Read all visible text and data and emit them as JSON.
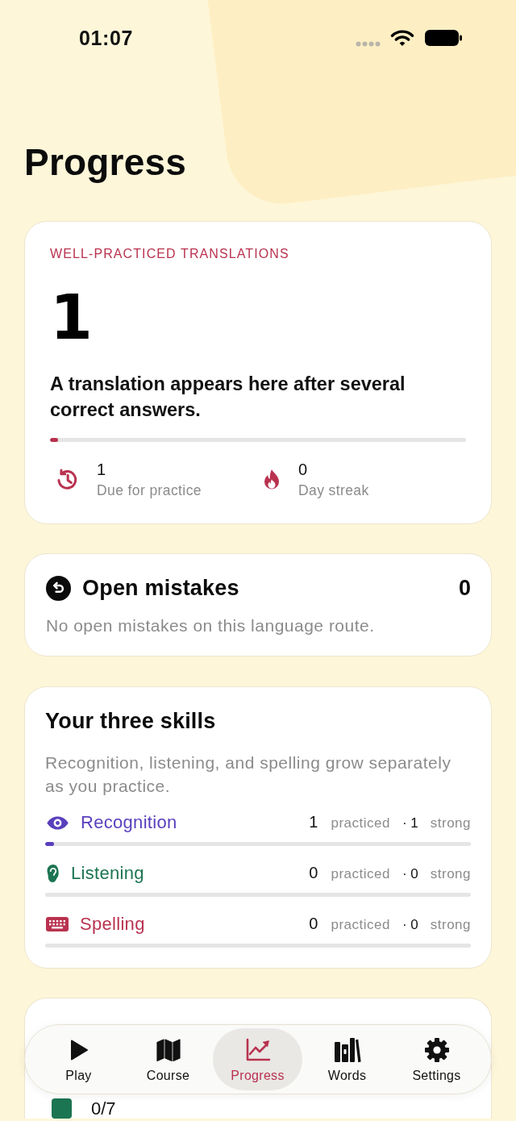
{
  "status_bar": {
    "time": "01:07"
  },
  "title": "Progress",
  "translations_card": {
    "label": "WELL-PRACTICED TRANSLATIONS",
    "count": "1",
    "message": "A translation appears here after several correct answers.",
    "level": 0.02,
    "stats": [
      {
        "kind": "due",
        "value": "1",
        "label": "Due for practice"
      },
      {
        "kind": "streak",
        "value": "0",
        "label": "Day streak"
      }
    ]
  },
  "mistakes_card": {
    "title": "Open mistakes",
    "count": "0",
    "message": "No open mistakes on this language route."
  },
  "skills_card": {
    "title": "Your three skills",
    "description": "Recognition, listening, and spelling grow separately as you practice.",
    "skills": [
      {
        "kind": "recognition",
        "name": "Recognition",
        "color": "#5a40bd",
        "practiced": "1",
        "practiced_label": "practiced",
        "strong": "· 1",
        "strong_label": "strong",
        "level": 0.02
      },
      {
        "kind": "listening",
        "name": "Listening",
        "color": "#1c7552",
        "practiced": "0",
        "practiced_label": "practiced",
        "strong": "· 0",
        "strong_label": "strong",
        "level": 0
      },
      {
        "kind": "spelling",
        "name": "Spelling",
        "color": "#b9324f",
        "practiced": "0",
        "practiced_label": "practiced",
        "strong": "· 0",
        "strong_label": "strong",
        "level": 0
      }
    ]
  },
  "lower_card": {
    "count": "0/7"
  },
  "tab_bar": {
    "tabs": [
      {
        "kind": "play",
        "label": "Play",
        "selected": false
      },
      {
        "kind": "course",
        "label": "Course",
        "selected": false
      },
      {
        "kind": "progress",
        "label": "Progress",
        "selected": true
      },
      {
        "kind": "words",
        "label": "Words",
        "selected": false
      },
      {
        "kind": "settings",
        "label": "Settings",
        "selected": false
      }
    ]
  }
}
